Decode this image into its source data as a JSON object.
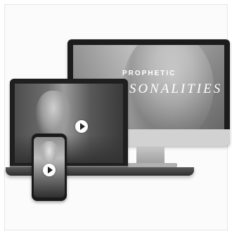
{
  "monitor": {
    "title_top": "PROPHETIC",
    "title_main": "PERSONALITIES"
  },
  "icons": {
    "laptop_play": "play-icon",
    "phone_play": "play-icon"
  },
  "colors": {
    "play_button": "#ffffff",
    "device_frame": "#1c1c1c"
  }
}
